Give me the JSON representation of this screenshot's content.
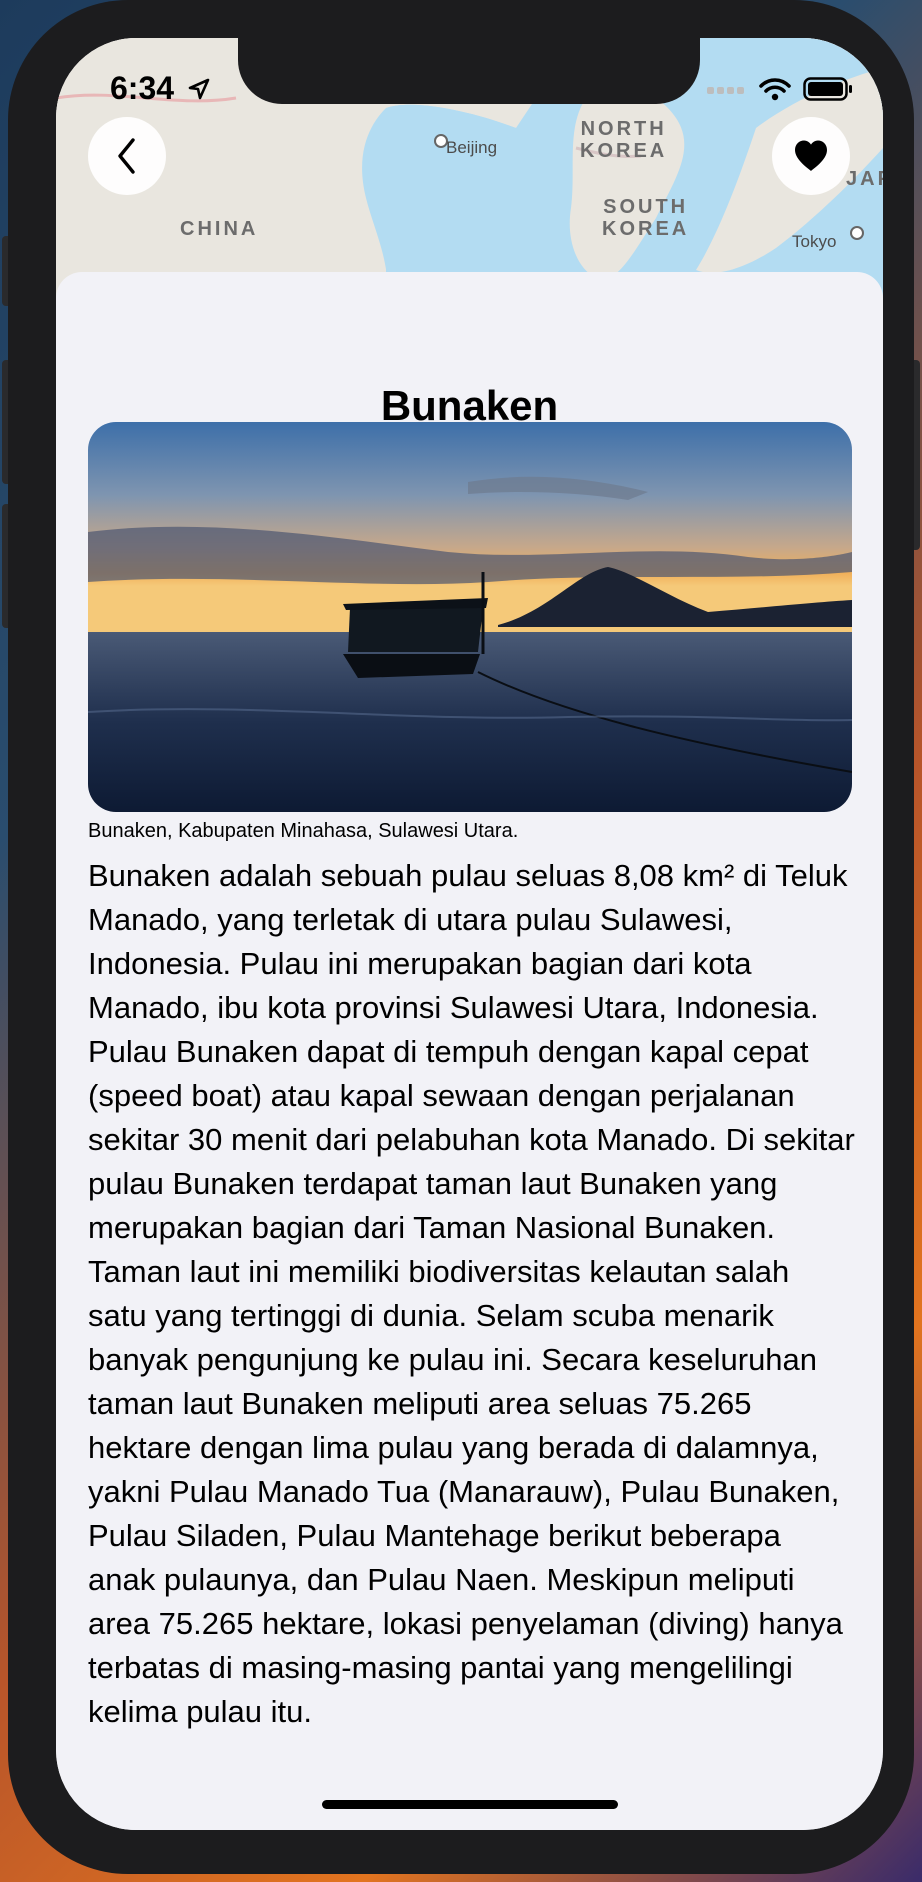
{
  "status_bar": {
    "time": "6:34"
  },
  "map": {
    "countries": [
      "CHINA",
      "NORTH\nKOREA",
      "SOUTH\nKOREA",
      "JAPA"
    ],
    "cities": [
      "Beijing",
      "Tokyo"
    ]
  },
  "nav": {
    "back_icon": "chevron-left-icon",
    "favorite_icon": "heart-filled-icon"
  },
  "place": {
    "title": "Bunaken",
    "caption": "Bunaken, Kabupaten Minahasa, Sulawesi Utara.",
    "description": "Bunaken adalah sebuah pulau seluas 8,08 km² di Teluk Manado, yang terletak di utara pulau Sulawesi, Indonesia. Pulau ini merupakan bagian dari kota Manado, ibu kota provinsi Sulawesi Utara, Indonesia. Pulau Bunaken dapat di tempuh dengan kapal cepat (speed boat) atau kapal sewaan dengan perjalanan sekitar 30 menit dari pelabuhan kota Manado. Di sekitar pulau Bunaken terdapat taman laut Bunaken yang merupakan bagian dari Taman Nasional Bunaken. Taman laut ini memiliki biodiversitas kelautan salah satu yang tertinggi di dunia. Selam scuba menarik banyak pengunjung ke pulau ini. Secara keseluruhan taman laut Bunaken meliputi area seluas 75.265 hektare dengan lima pulau yang berada di dalamnya, yakni Pulau Manado Tua (Manarauw), Pulau Bunaken, Pulau Siladen, Pulau Mantehage berikut beberapa anak pulaunya, dan Pulau Naen. Meskipun meliputi area 75.265 hektare, lokasi penyelaman (diving) hanya terbatas di masing-masing pantai yang mengelilingi kelima pulau itu."
  }
}
